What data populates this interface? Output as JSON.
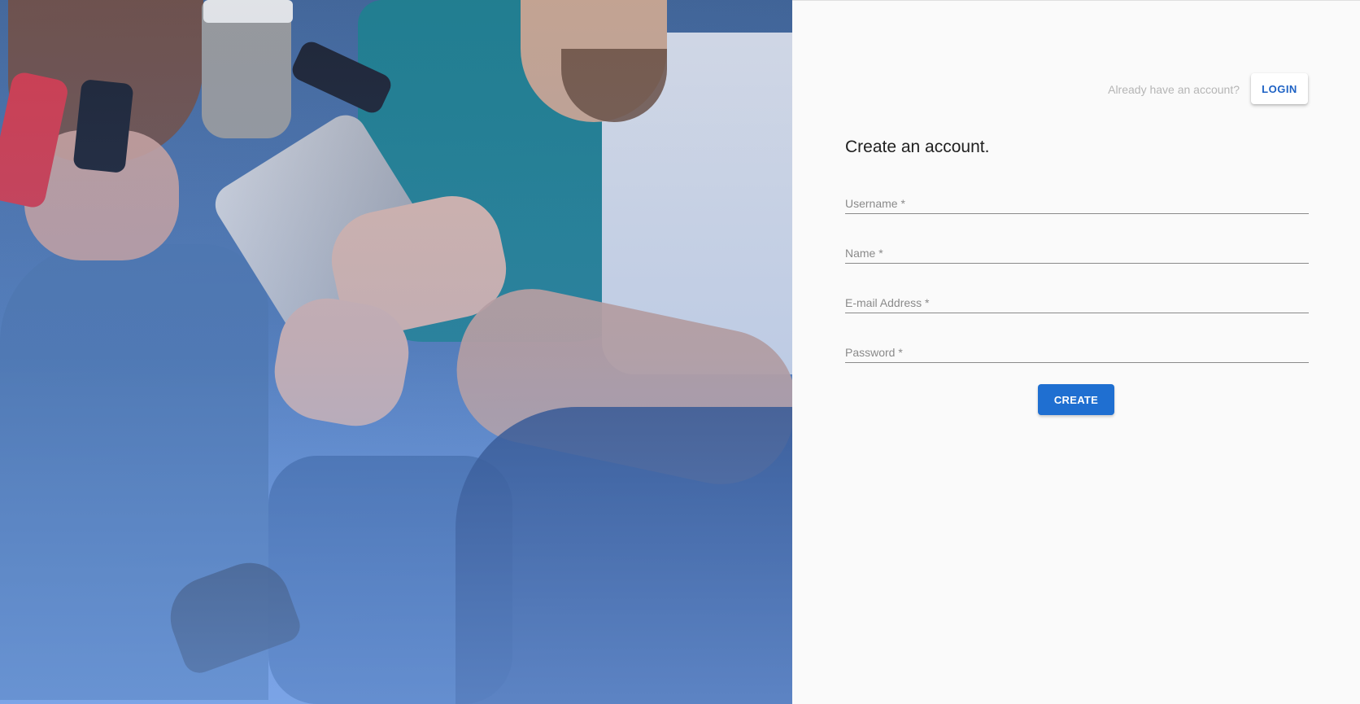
{
  "hero": {
    "image_description": "Photo of friends using phones and a tablet, blue tinted",
    "colors": {
      "tint": "#4e78b4",
      "fade": "#86acee"
    }
  },
  "header": {
    "already_text": "Already have an account?",
    "login_label": "LOGIN"
  },
  "form": {
    "title": "Create an account.",
    "fields": [
      {
        "label": "Username *",
        "value": ""
      },
      {
        "label": "Name *",
        "value": ""
      },
      {
        "label": "E-mail Address *",
        "value": ""
      },
      {
        "label": "Password *",
        "value": ""
      }
    ],
    "submit_label": "CREATE"
  },
  "colors": {
    "accent": "#1f6fd1",
    "background": "#fafafa",
    "label": "#8a8a8a"
  }
}
